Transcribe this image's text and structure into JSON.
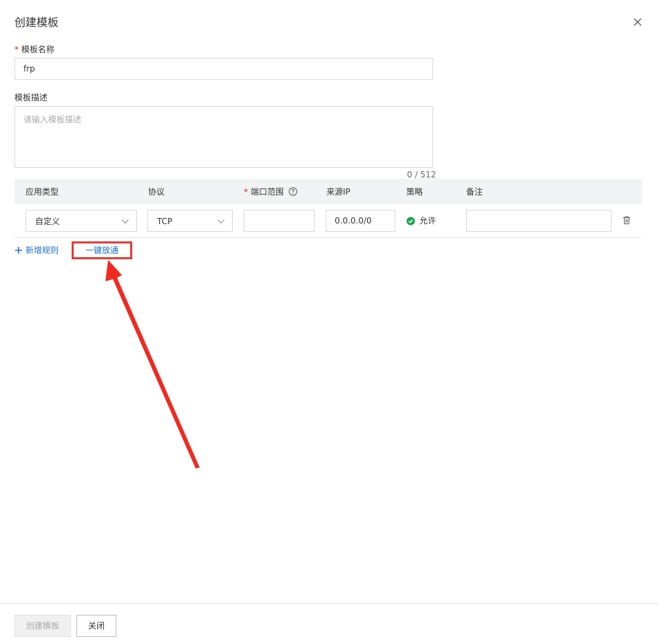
{
  "dialog": {
    "title": "创建模板"
  },
  "form": {
    "name_required_mark": "*",
    "name_label": "模板名称",
    "name_value": "frp",
    "desc_label": "模板描述",
    "desc_placeholder": "请输入模板描述",
    "desc_counter": "0 / 512"
  },
  "table": {
    "headers": {
      "app_type": "应用类型",
      "protocol": "协议",
      "port_required_mark": "*",
      "port_range": "端口范围",
      "source_ip": "来源IP",
      "policy": "策略",
      "remark": "备注"
    },
    "rows": [
      {
        "app_type": "自定义",
        "protocol": "TCP",
        "port_range": "",
        "source_ip": "0.0.0.0/0",
        "policy": "允许",
        "remark": ""
      }
    ]
  },
  "actions": {
    "add_rule": "新增规则",
    "one_click": "一键放通"
  },
  "footer": {
    "create_button": "创建模板",
    "close_button": "关闭"
  },
  "colors": {
    "link": "#1a6fd1",
    "policy_allow": "#1aa34a",
    "annotation": "#e53935"
  },
  "icons": {
    "close": "close-icon",
    "help": "help-circle-icon",
    "chevron": "chevron-down-icon",
    "allow": "check-circle-icon",
    "delete": "trash-icon",
    "add": "plus-icon"
  }
}
